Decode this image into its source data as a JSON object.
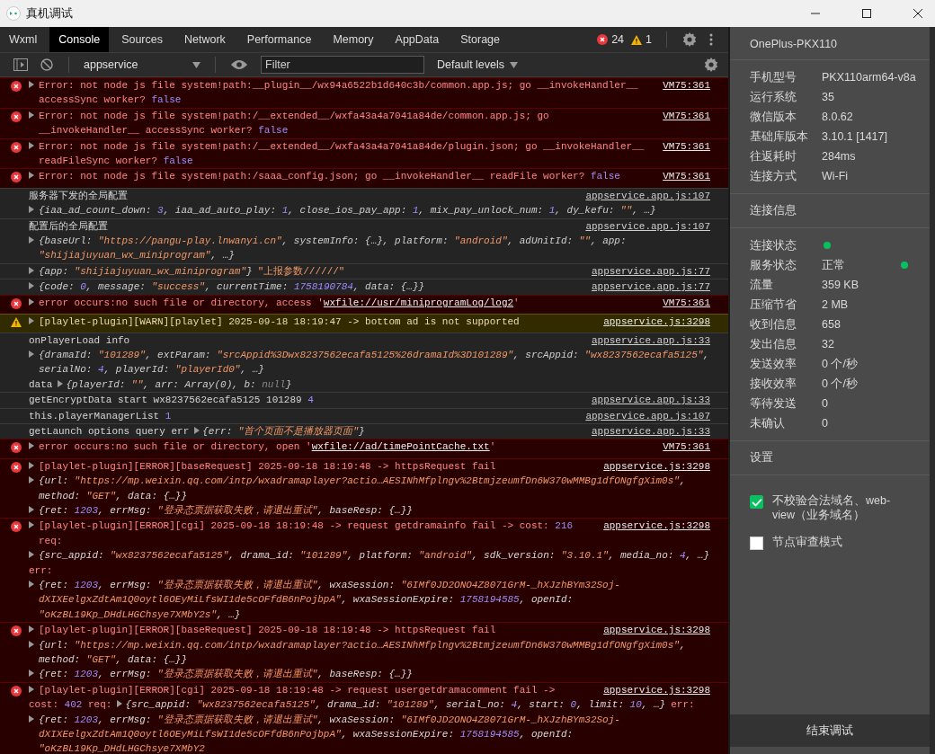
{
  "window": {
    "title": "真机调试"
  },
  "tabs": [
    {
      "label": "Wxml",
      "selected": false
    },
    {
      "label": "Console",
      "selected": true
    },
    {
      "label": "Sources",
      "selected": false
    },
    {
      "label": "Network",
      "selected": false
    },
    {
      "label": "Performance",
      "selected": false
    },
    {
      "label": "Memory",
      "selected": false
    },
    {
      "label": "AppData",
      "selected": false
    },
    {
      "label": "Storage",
      "selected": false
    }
  ],
  "counters": {
    "errors": "24",
    "warnings": "1"
  },
  "toolbar": {
    "context": "appservice",
    "filter_placeholder": "Filter",
    "levels": "Default levels"
  },
  "logs": [
    {
      "kind": "error",
      "source": "VM75:361",
      "lines": [
        [
          {
            "kind": "toggle"
          },
          {
            "kind": "message",
            "parts": [
              {
                "kind": "plain",
                "text": "Error: not node js file system!path:__plugin__/wx94a6522b1d640c3b/common.app.js; go __invokeHandler__ accessSync worker? "
              },
              {
                "kind": "kw",
                "text": "false"
              }
            ]
          }
        ]
      ]
    },
    {
      "kind": "error",
      "source": "VM75:361",
      "lines": [
        [
          {
            "kind": "toggle"
          },
          {
            "kind": "message",
            "parts": [
              {
                "kind": "plain",
                "text": "Error: not node js file system!path:/__extended__/wxfa43a4a7041a84de/common.app.js; go __invokeHandler__ accessSync worker? "
              },
              {
                "kind": "kw",
                "text": "false"
              }
            ]
          }
        ]
      ]
    },
    {
      "kind": "error",
      "source": "VM75:361",
      "lines": [
        [
          {
            "kind": "toggle"
          },
          {
            "kind": "message",
            "parts": [
              {
                "kind": "plain",
                "text": "Error: not node js file system!path:/__extended__/wxfa43a4a7041a84de/plugin.json; go __invokeHandler__ readFileSync worker? "
              },
              {
                "kind": "kw",
                "text": "false"
              }
            ]
          }
        ]
      ]
    },
    {
      "kind": "error",
      "source": "VM75:361",
      "lines": [
        [
          {
            "kind": "toggle"
          },
          {
            "kind": "message",
            "parts": [
              {
                "kind": "plain",
                "text": "Error: not node js file system!path:/saaa_config.json; go __invokeHandler__ readFile worker? "
              },
              {
                "kind": "kw",
                "text": "false"
              }
            ]
          }
        ]
      ]
    },
    {
      "kind": "info",
      "source": "appservice.app.js:107",
      "lines": [
        [
          {
            "kind": "message",
            "parts": [
              {
                "kind": "plain",
                "text": "服务器下发的全局配置"
              }
            ]
          }
        ],
        [
          {
            "kind": "toggle"
          },
          {
            "kind": "object",
            "parts": [
              {
                "kind": "plain",
                "text": "{iaa_ad_count_down: "
              },
              {
                "kind": "num",
                "text": "3"
              },
              {
                "kind": "plain",
                "text": ", iaa_ad_auto_play: "
              },
              {
                "kind": "num",
                "text": "1"
              },
              {
                "kind": "plain",
                "text": ", close_ios_pay_app: "
              },
              {
                "kind": "num",
                "text": "1"
              },
              {
                "kind": "plain",
                "text": ", mix_pay_unlock_num: "
              },
              {
                "kind": "num",
                "text": "1"
              },
              {
                "kind": "plain",
                "text": ", dy_kefu: "
              },
              {
                "kind": "str",
                "text": "\"\""
              },
              {
                "kind": "plain",
                "text": ", …}"
              }
            ]
          }
        ]
      ]
    },
    {
      "kind": "info",
      "source": "appservice.app.js:107",
      "lines": [
        [
          {
            "kind": "message",
            "parts": [
              {
                "kind": "plain",
                "text": "配置后的全局配置"
              }
            ]
          }
        ],
        [
          {
            "kind": "toggle"
          },
          {
            "kind": "object",
            "parts": [
              {
                "kind": "plain",
                "text": "{baseUrl: "
              },
              {
                "kind": "str",
                "text": "\"https://pangu-play.lnwanyi.cn\""
              },
              {
                "kind": "plain",
                "text": ", systemInfo: {…}, platform: "
              },
              {
                "kind": "str",
                "text": "\"android\""
              },
              {
                "kind": "plain",
                "text": ", adUnitId: "
              },
              {
                "kind": "str",
                "text": "\"\""
              },
              {
                "kind": "plain",
                "text": ", app: "
              },
              {
                "kind": "str",
                "text": "\"shijiajuyuan_wx_miniprogram\""
              },
              {
                "kind": "plain",
                "text": ", …}"
              }
            ]
          }
        ]
      ]
    },
    {
      "kind": "info",
      "source": "appservice.app.js:77",
      "lines": [
        [
          {
            "kind": "toggle"
          },
          {
            "kind": "object",
            "parts": [
              {
                "kind": "plain",
                "text": "{app: "
              },
              {
                "kind": "str",
                "text": "\"shijiajuyuan_wx_miniprogram\""
              },
              {
                "kind": "plain",
                "text": "}"
              }
            ]
          },
          {
            "kind": "message",
            "parts": [
              {
                "kind": "str",
                "text": "\"上报参数//////\""
              }
            ]
          }
        ]
      ]
    },
    {
      "kind": "info",
      "source": "appservice.app.js:77",
      "lines": [
        [
          {
            "kind": "toggle"
          },
          {
            "kind": "object",
            "parts": [
              {
                "kind": "plain",
                "text": "{code: "
              },
              {
                "kind": "num",
                "text": "0"
              },
              {
                "kind": "plain",
                "text": ", message: "
              },
              {
                "kind": "str",
                "text": "\"success\""
              },
              {
                "kind": "plain",
                "text": ", currentTime: "
              },
              {
                "kind": "num",
                "text": "1758190784"
              },
              {
                "kind": "plain",
                "text": ", data: {…}}"
              }
            ]
          }
        ]
      ]
    },
    {
      "kind": "error",
      "source": "VM75:361",
      "lines": [
        [
          {
            "kind": "toggle"
          },
          {
            "kind": "message",
            "parts": [
              {
                "kind": "plain",
                "text": "error occurs:no such file or directory, access '"
              },
              {
                "kind": "link",
                "text": "wxfile://usr/miniprogramLog/log2"
              },
              {
                "kind": "plain",
                "text": "'"
              }
            ]
          }
        ]
      ]
    },
    {
      "kind": "warning",
      "source": "appservice.js:3298",
      "lines": [
        [
          {
            "kind": "toggle"
          },
          {
            "kind": "message",
            "parts": [
              {
                "kind": "plain",
                "text": "[playlet-plugin][WARN][playlet] 2025-09-18 18:19:47 -> bottom ad is not supported"
              }
            ]
          }
        ]
      ]
    },
    {
      "kind": "info",
      "source": "appservice.app.js:33",
      "lines": [
        [
          {
            "kind": "message",
            "parts": [
              {
                "kind": "plain",
                "text": "onPlayerLoad info"
              }
            ]
          }
        ],
        [
          {
            "kind": "toggle"
          },
          {
            "kind": "object",
            "parts": [
              {
                "kind": "plain",
                "text": "{dramaId: "
              },
              {
                "kind": "str",
                "text": "\"101289\""
              },
              {
                "kind": "plain",
                "text": ", extParam: "
              },
              {
                "kind": "str",
                "text": "\"srcAppid%3Dwx8237562ecafa5125%26dramaId%3D101289\""
              },
              {
                "kind": "plain",
                "text": ", srcAppid: "
              },
              {
                "kind": "str",
                "text": "\"wx8237562ecafa5125\""
              },
              {
                "kind": "plain",
                "text": ", serialNo: "
              },
              {
                "kind": "num",
                "text": "4"
              },
              {
                "kind": "plain",
                "text": ", playerId: "
              },
              {
                "kind": "str",
                "text": "\"playerId0\""
              },
              {
                "kind": "plain",
                "text": ", …}"
              }
            ]
          }
        ],
        [
          {
            "kind": "message",
            "parts": [
              {
                "kind": "plain",
                "text": "data"
              }
            ]
          },
          {
            "kind": "toggle"
          },
          {
            "kind": "object",
            "parts": [
              {
                "kind": "plain",
                "text": "{playerId: "
              },
              {
                "kind": "str",
                "text": "\"\""
              },
              {
                "kind": "plain",
                "text": ", arr: Array(0), b: "
              },
              {
                "kind": "nul",
                "text": "null"
              },
              {
                "kind": "plain",
                "text": "}"
              }
            ]
          }
        ]
      ]
    },
    {
      "kind": "info",
      "source": "appservice.app.js:33",
      "lines": [
        [
          {
            "kind": "message",
            "parts": [
              {
                "kind": "plain",
                "text": "getEncryptData start wx8237562ecafa5125 101289 "
              },
              {
                "kind": "kw",
                "text": "4"
              }
            ]
          }
        ]
      ]
    },
    {
      "kind": "info",
      "source": "appservice.app.js:107",
      "lines": [
        [
          {
            "kind": "message",
            "parts": [
              {
                "kind": "plain",
                "text": "this.playerManagerList "
              },
              {
                "kind": "kw",
                "text": "1"
              }
            ]
          }
        ]
      ]
    },
    {
      "kind": "info",
      "source": "appservice.app.js:33",
      "lines": [
        [
          {
            "kind": "message",
            "parts": [
              {
                "kind": "plain",
                "text": "getLaunch options query err"
              }
            ]
          },
          {
            "kind": "toggle"
          },
          {
            "kind": "object",
            "parts": [
              {
                "kind": "plain",
                "text": "{err: "
              },
              {
                "kind": "str",
                "text": "\"首个页面不是播放器页面\""
              },
              {
                "kind": "plain",
                "text": "}"
              }
            ]
          }
        ]
      ]
    },
    {
      "kind": "error",
      "source": "VM75:361",
      "lines": [
        [
          {
            "kind": "toggle"
          },
          {
            "kind": "message",
            "parts": [
              {
                "kind": "plain",
                "text": "error occurs:no such file or directory, open '"
              },
              {
                "kind": "link",
                "text": "wxfile://ad/timePointCache.txt"
              },
              {
                "kind": "plain",
                "text": "'"
              }
            ]
          }
        ]
      ]
    },
    {
      "kind": "error",
      "source": "appservice.js:3298",
      "lines": [
        [
          {
            "kind": "toggle"
          },
          {
            "kind": "message",
            "parts": [
              {
                "kind": "plain",
                "text": "[playlet-plugin][ERROR][baseRequest] 2025-09-18 18:19:48 -> httpsRequest fail"
              }
            ]
          }
        ],
        [
          {
            "kind": "toggle"
          },
          {
            "kind": "object",
            "parts": [
              {
                "kind": "plain",
                "text": "{url: "
              },
              {
                "kind": "str",
                "text": "\"https://mp.weixin.qq.com/intp/wxadramaplayer?actio…AESINhMfplngv%2BtmjzeumfDn6W370wMMBg1dfONgfgXim0s\""
              },
              {
                "kind": "plain",
                "text": ", method: "
              },
              {
                "kind": "str",
                "text": "\"GET\""
              },
              {
                "kind": "plain",
                "text": ", data: {…}}"
              }
            ]
          }
        ],
        [
          {
            "kind": "toggle"
          },
          {
            "kind": "object",
            "parts": [
              {
                "kind": "plain",
                "text": "{ret: "
              },
              {
                "kind": "num",
                "text": "1203"
              },
              {
                "kind": "plain",
                "text": ", errMsg: "
              },
              {
                "kind": "str",
                "text": "\"登录态票据获取失败，请退出重试\""
              },
              {
                "kind": "plain",
                "text": ", baseResp: {…}}"
              }
            ]
          }
        ]
      ]
    },
    {
      "kind": "error",
      "source": "appservice.js:3298",
      "lines": [
        [
          {
            "kind": "toggle"
          },
          {
            "kind": "message",
            "parts": [
              {
                "kind": "plain",
                "text": "[playlet-plugin][ERROR][cgi] 2025-09-18 18:19:48 -> request getdramainfo fail -> cost: "
              },
              {
                "kind": "kw",
                "text": "216"
              },
              {
                "kind": "plain",
                "text": " req:"
              }
            ]
          }
        ],
        [
          {
            "kind": "toggle"
          },
          {
            "kind": "object",
            "parts": [
              {
                "kind": "plain",
                "text": "{src_appid: "
              },
              {
                "kind": "str",
                "text": "\"wx8237562ecafa5125\""
              },
              {
                "kind": "plain",
                "text": ", drama_id: "
              },
              {
                "kind": "str",
                "text": "\"101289\""
              },
              {
                "kind": "plain",
                "text": ", platform: "
              },
              {
                "kind": "str",
                "text": "\"android\""
              },
              {
                "kind": "plain",
                "text": ", sdk_version: "
              },
              {
                "kind": "str",
                "text": "\"3.10.1\""
              },
              {
                "kind": "plain",
                "text": ", media_no: "
              },
              {
                "kind": "num",
                "text": "4"
              },
              {
                "kind": "plain",
                "text": ", …}"
              }
            ]
          }
        ],
        [
          {
            "kind": "message",
            "parts": [
              {
                "kind": "plain",
                "text": "err:"
              }
            ]
          }
        ],
        [
          {
            "kind": "toggle"
          },
          {
            "kind": "object",
            "parts": [
              {
                "kind": "plain",
                "text": "{ret: "
              },
              {
                "kind": "num",
                "text": "1203"
              },
              {
                "kind": "plain",
                "text": ", errMsg: "
              },
              {
                "kind": "str",
                "text": "\"登录态票据获取失败，请退出重试\""
              },
              {
                "kind": "plain",
                "text": ", wxaSession: "
              },
              {
                "kind": "str",
                "text": "\"6IMf0JD2ONO4Z8071GrM-_hXJzhBYm32Soj-dXIXEelgxZdtAm1Q0oytl6OEyMiLfsWI1de5cOFfdB6nPojbpA\""
              },
              {
                "kind": "plain",
                "text": ", wxaSessionExpire: "
              },
              {
                "kind": "num",
                "text": "1758194585"
              },
              {
                "kind": "plain",
                "text": ", openId: "
              },
              {
                "kind": "str",
                "text": "\"oKzBL19Kp_DHdLHGChsye7XMbY2s\""
              },
              {
                "kind": "plain",
                "text": ", …}"
              }
            ]
          }
        ]
      ]
    },
    {
      "kind": "error",
      "source": "appservice.js:3298",
      "lines": [
        [
          {
            "kind": "toggle"
          },
          {
            "kind": "message",
            "parts": [
              {
                "kind": "plain",
                "text": "[playlet-plugin][ERROR][baseRequest] 2025-09-18 18:19:48 -> httpsRequest fail"
              }
            ]
          }
        ],
        [
          {
            "kind": "toggle"
          },
          {
            "kind": "object",
            "parts": [
              {
                "kind": "plain",
                "text": "{url: "
              },
              {
                "kind": "str",
                "text": "\"https://mp.weixin.qq.com/intp/wxadramaplayer?actio…AESINhMfplngv%2BtmjzeumfDn6W370wMMBg1dfONgfgXim0s\""
              },
              {
                "kind": "plain",
                "text": ", method: "
              },
              {
                "kind": "str",
                "text": "\"GET\""
              },
              {
                "kind": "plain",
                "text": ", data: {…}}"
              }
            ]
          }
        ],
        [
          {
            "kind": "toggle"
          },
          {
            "kind": "object",
            "parts": [
              {
                "kind": "plain",
                "text": "{ret: "
              },
              {
                "kind": "num",
                "text": "1203"
              },
              {
                "kind": "plain",
                "text": ", errMsg: "
              },
              {
                "kind": "str",
                "text": "\"登录态票据获取失败，请退出重试\""
              },
              {
                "kind": "plain",
                "text": ", baseResp: {…}}"
              }
            ]
          }
        ]
      ]
    },
    {
      "kind": "error",
      "source": "appservice.js:3298",
      "lines": [
        [
          {
            "kind": "toggle"
          },
          {
            "kind": "message",
            "parts": [
              {
                "kind": "plain",
                "text": "[playlet-plugin][ERROR][cgi] 2025-09-18 18:19:48 -> request usergetdramacomment fail ->"
              }
            ]
          }
        ],
        [
          {
            "kind": "message",
            "parts": [
              {
                "kind": "plain",
                "text": "cost: "
              },
              {
                "kind": "kw",
                "text": "402"
              },
              {
                "kind": "plain",
                "text": " req:"
              }
            ]
          },
          {
            "kind": "toggle"
          },
          {
            "kind": "object",
            "parts": [
              {
                "kind": "plain",
                "text": "{src_appid: "
              },
              {
                "kind": "str",
                "text": "\"wx8237562ecafa5125\""
              },
              {
                "kind": "plain",
                "text": ", drama_id: "
              },
              {
                "kind": "str",
                "text": "\"101289\""
              },
              {
                "kind": "plain",
                "text": ", serial_no: "
              },
              {
                "kind": "num",
                "text": "4"
              },
              {
                "kind": "plain",
                "text": ", start: "
              },
              {
                "kind": "num",
                "text": "0"
              },
              {
                "kind": "plain",
                "text": ", limit: "
              },
              {
                "kind": "num",
                "text": "10"
              },
              {
                "kind": "plain",
                "text": ", …}"
              }
            ]
          },
          {
            "kind": "message",
            "parts": [
              {
                "kind": "plain",
                "text": "err:"
              }
            ]
          }
        ],
        [
          {
            "kind": "toggle"
          },
          {
            "kind": "object",
            "parts": [
              {
                "kind": "plain",
                "text": "{ret: "
              },
              {
                "kind": "num",
                "text": "1203"
              },
              {
                "kind": "plain",
                "text": ", errMsg: "
              },
              {
                "kind": "str",
                "text": "\"登录态票据获取失败，请退出重试\""
              },
              {
                "kind": "plain",
                "text": ", wxaSession: "
              },
              {
                "kind": "str",
                "text": "\"6IMf0JD2ONO4Z8071GrM-_hXJzhBYm32Soj-dXIXEelgxZdtAm1Q0oytl6OEyMiLfsWI1de5cOFfdB6nPojbpA\""
              },
              {
                "kind": "plain",
                "text": ", wxaSessionExpire: "
              },
              {
                "kind": "num",
                "text": "1758194585"
              },
              {
                "kind": "plain",
                "text": ", openId: "
              },
              {
                "kind": "str",
                "text": "\"oKzBL19Kp_DHdLHGChsye7XMbY2"
              }
            ]
          }
        ]
      ]
    }
  ],
  "device": {
    "name": "OnePlus-PKX110",
    "info": [
      {
        "label": "手机型号",
        "value": "PKX110arm64-v8a"
      },
      {
        "label": "运行系统",
        "value": "35"
      },
      {
        "label": "微信版本",
        "value": "8.0.62"
      },
      {
        "label": "基础库版本",
        "value": "3.10.1 [1417]"
      },
      {
        "label": "往返耗时",
        "value": "284ms"
      },
      {
        "label": "连接方式",
        "value": "Wi-Fi"
      }
    ],
    "connection_title": "连接信息",
    "connection": [
      {
        "label": "连接状态",
        "indicator": true
      },
      {
        "label": "服务状态",
        "value": "正常",
        "indicator": true
      },
      {
        "label": "流量",
        "value": "359 KB",
        "indicator": false
      },
      {
        "label": "压缩节省",
        "value": "2 MB",
        "indicator": false
      },
      {
        "label": "收到信息",
        "value": "658",
        "indicator": false
      },
      {
        "label": "发出信息",
        "value": "32",
        "indicator": false
      },
      {
        "label": "发送效率",
        "value": "0 个/秒",
        "indicator": false
      },
      {
        "label": "接收效率",
        "value": "0 个/秒",
        "indicator": false
      },
      {
        "label": "等待发送",
        "value": "0",
        "indicator": false
      },
      {
        "label": "未确认",
        "value": "0",
        "indicator": false
      }
    ],
    "settings_title": "设置",
    "settings": [
      {
        "label": "不校验合法域名、web-view（业务域名）",
        "checked": true
      },
      {
        "label": "节点审查模式",
        "checked": false
      }
    ],
    "end_button": "结束调试"
  }
}
